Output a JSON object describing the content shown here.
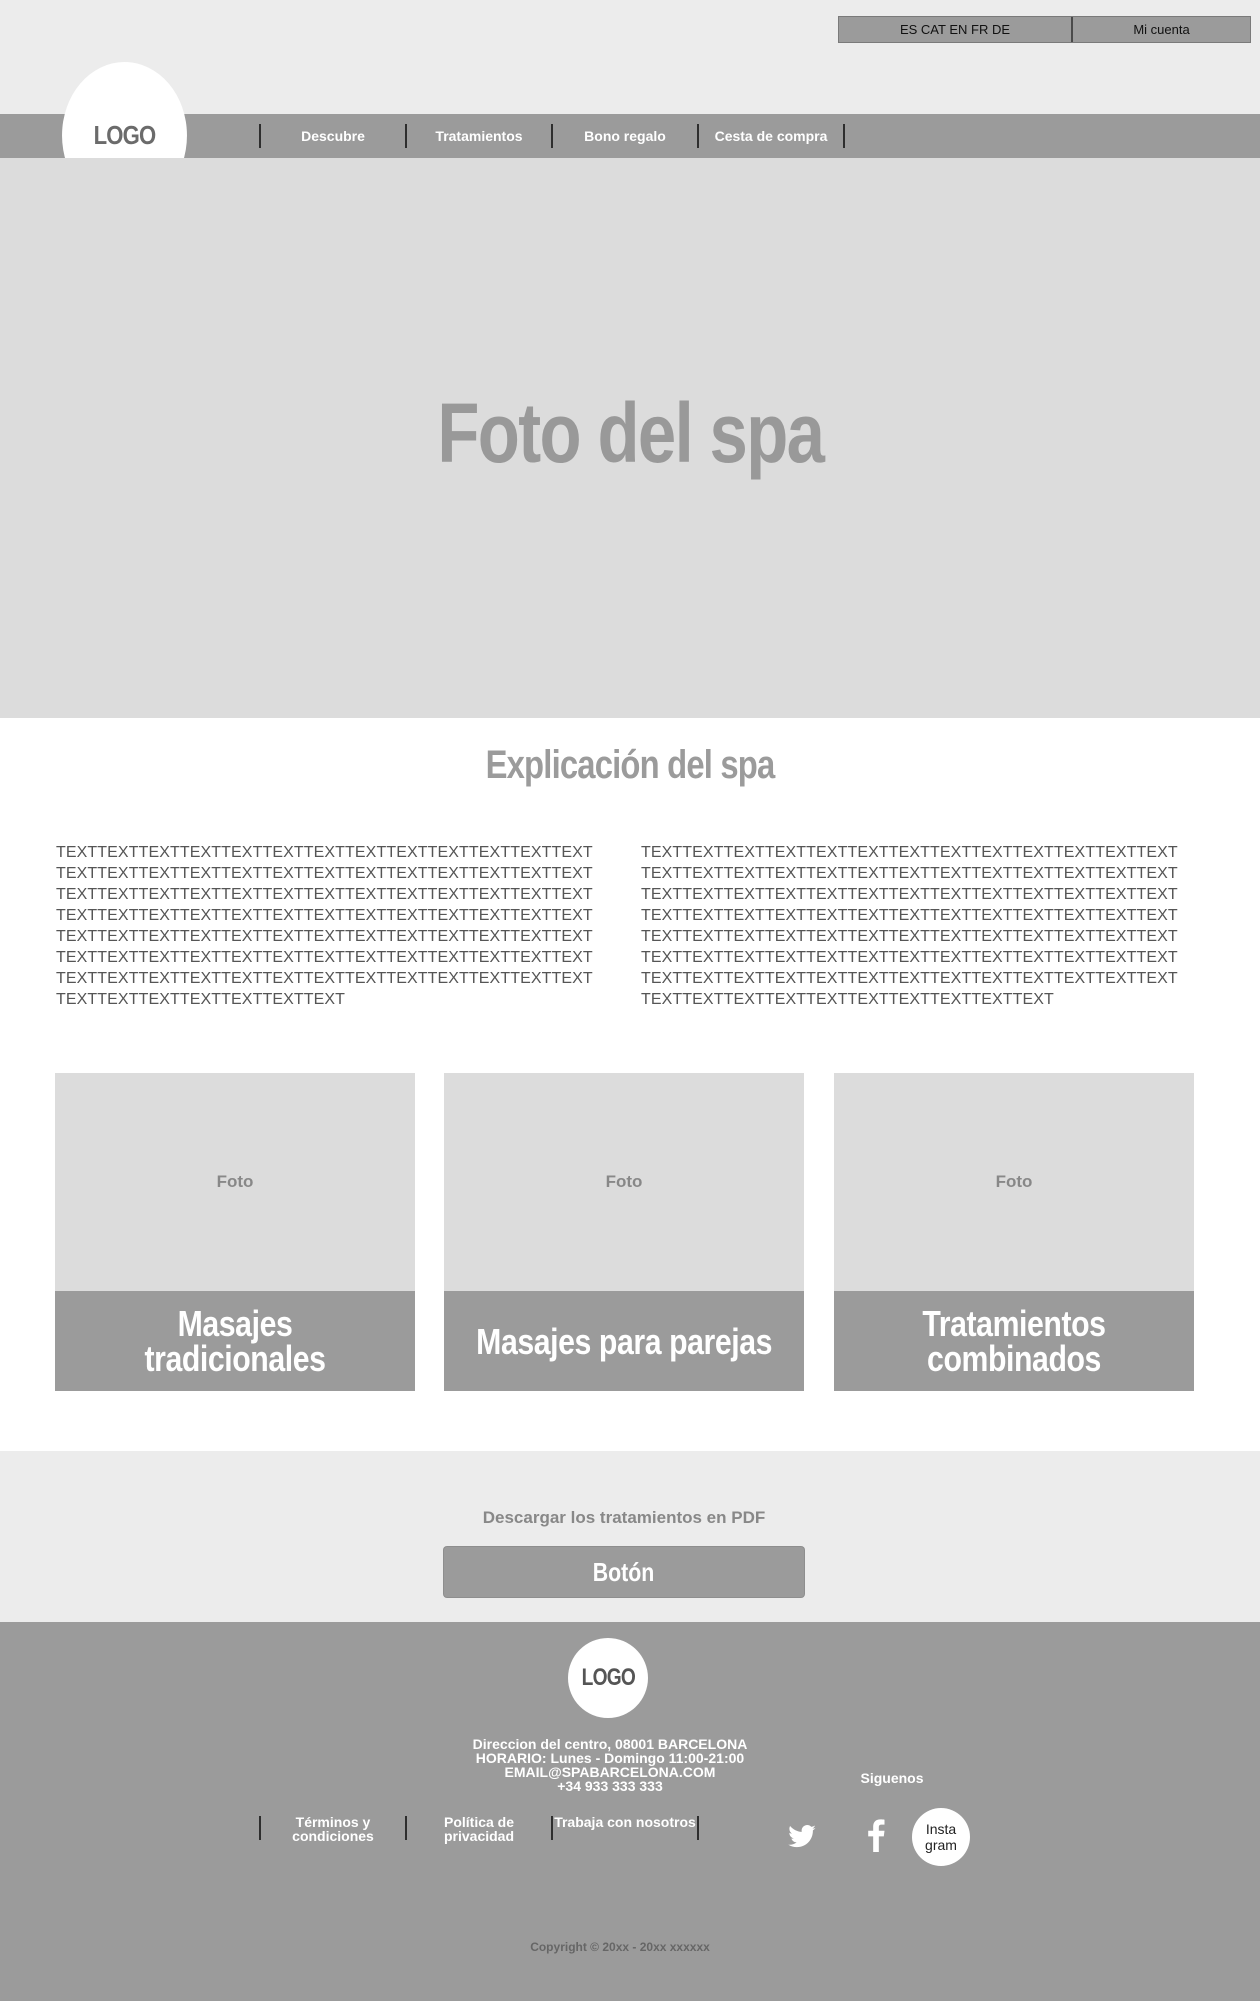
{
  "header": {
    "languages": "ES CAT EN FR DE",
    "account": "Mi cuenta",
    "logo": "LOGO"
  },
  "nav": {
    "items": [
      "Descubre",
      "Tratamientos",
      "Bono regalo",
      "Cesta de compra"
    ]
  },
  "hero": {
    "title": "Foto del spa"
  },
  "explanation": {
    "title": "Explicación del spa",
    "col1": "TEXTTEXTTEXTTEXTTEXTTEXTTEXTTEXTTEXTTEXTTEXTTEXTTEXTTEXTTEXTTEXTTEXTTEXTTEXTTEXTTEXTTEXTTEXTTEXTTEXTTEXTTEXTTEXTTEXTTEXTTEXTTEXTTEXTTEXTTEXTTEXTTEXTTEXTTEXTTEXTTEXTTEXTTEXTTEXTTEXTTEXTTEXTTEXTTEXTTEXTTEXTTEXTTEXTTEXTTEXTTEXTTEXTTEXTTEXTTEXTTEXTTEXTTEXTTEXTTEXTTEXTTEXTTEXTTEXTTEXTTEXTTEXTTEXTTEXTTEXTTEXTTEXTTEXTTEXTTEXTTEXTTEXTTEXTTEXTTEXTTEXTTEXTTEXTTEXTTEXTTEXTTEXTTEXTTEXTTEXTTEXTTEXTTEXT",
    "col2": "TEXTTEXTTEXTTEXTTEXTTEXTTEXTTEXTTEXTTEXTTEXTTEXTTEXTTEXTTEXTTEXTTEXTTEXTTEXTTEXTTEXTTEXTTEXTTEXTTEXTTEXTTEXTTEXTTEXTTEXTTEXTTEXTTEXTTEXTTEXTTEXTTEXTTEXTTEXTTEXTTEXTTEXTTEXTTEXTTEXTTEXTTEXTTEXTTEXTTEXTTEXTTEXTTEXTTEXTTEXTTEXTTEXTTEXTTEXTTEXTTEXTTEXTTEXTTEXTTEXTTEXTTEXTTEXTTEXTTEXTTEXTTEXTTEXTTEXTTEXTTEXTTEXTTEXTTEXTTEXTTEXTTEXTTEXTTEXTTEXTTEXTTEXTTEXTTEXTTEXTTEXTTEXTTEXTTEXTTEXTTEXTTEXTTEXTTEXTTEXTTEXT"
  },
  "cards": [
    {
      "photo": "Foto",
      "label": "Masajes tradicionales"
    },
    {
      "photo": "Foto",
      "label": "Masajes para parejas"
    },
    {
      "photo": "Foto",
      "label": "Tratamientos combinados"
    }
  ],
  "download": {
    "text": "Descargar los tratamientos en PDF",
    "button": "Botón"
  },
  "footer": {
    "logo": "LOGO",
    "address": "Direccion del centro, 08001 BARCELONA",
    "hours": "HORARIO:  Lunes - Domingo 11:00-21:00",
    "email": "EMAIL@SPABARCELONA.COM",
    "phone": "+34 933 333 333",
    "links": [
      "Términos y condiciones",
      "Política de privacidad",
      "Trabaja con nosotros"
    ],
    "follow": "Siguenos",
    "social": [
      {
        "name": "twitter-icon"
      },
      {
        "name": "facebook-icon"
      },
      {
        "name": "instagram",
        "label": "Insta gram"
      }
    ],
    "copyright": "Copyright © 20xx - 20xx xxxxxx"
  },
  "colors": {
    "bar_gray": "#9b9b9b",
    "light_gray": "#ececec",
    "photo_gray": "#dcdcdc",
    "text_gray": "#555555"
  }
}
